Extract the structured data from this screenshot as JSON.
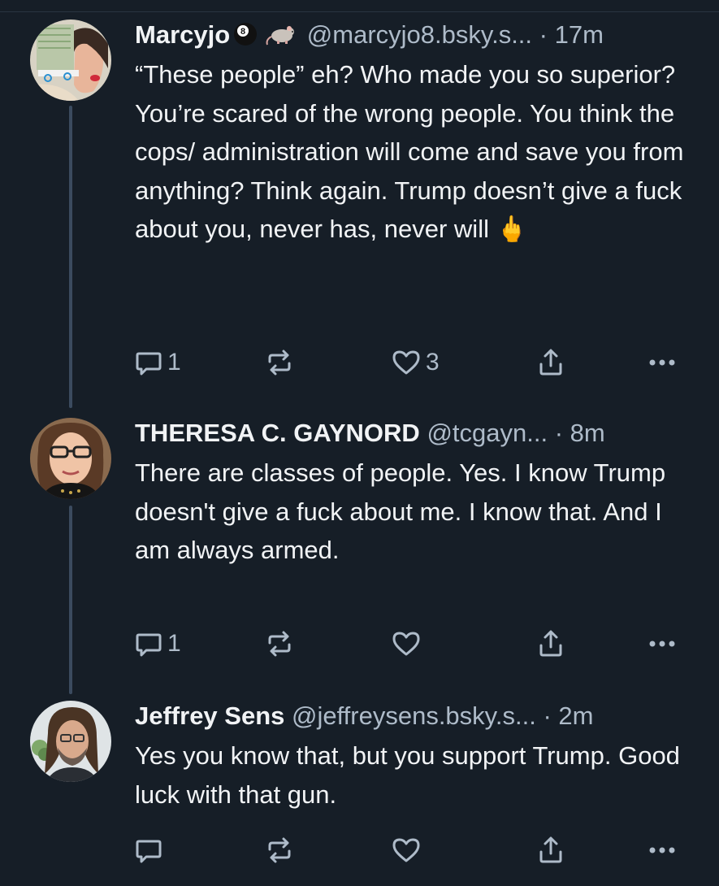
{
  "posts": [
    {
      "name": "Marcyjo",
      "name_emojis": [
        "8-ball-emoji",
        "rat-emoji"
      ],
      "handle": "@marcyjo8.bsky.s...",
      "separator": "·",
      "time": "17m",
      "text": "“These people” eh? Who made you so superior? You’re scared of the wrong people. You think the cops/ administration will come and save you from anything? Think again. Trump doesn’t give a fuck about you, never has, never will 🖕",
      "replies": "1",
      "reposts": "",
      "likes": "3"
    },
    {
      "name": "THERESA C. GAYNORD",
      "handle": "@tcgayn...",
      "separator": "·",
      "time": "8m",
      "text": "There are classes of people. Yes. I know Trump doesn't give a fuck about me. I know that. And I am always armed.",
      "replies": "1",
      "reposts": "",
      "likes": ""
    },
    {
      "name": "Jeffrey Sens",
      "handle": "@jeffreysens.bsky.s...",
      "separator": "·",
      "time": "2m",
      "text": "Yes you know that, but you support Trump. Good luck with that gun.",
      "replies": "",
      "reposts": "",
      "likes": ""
    }
  ],
  "colors": {
    "background": "#161e27",
    "text": "#f1f3f5",
    "muted": "#aebbc9",
    "thread_line": "#3b4b5f"
  },
  "icons": {
    "reply": "reply-bubble-icon",
    "repost": "repost-arrows-icon",
    "like": "heart-icon",
    "share": "share-upload-icon",
    "more": "more-dots-icon"
  }
}
